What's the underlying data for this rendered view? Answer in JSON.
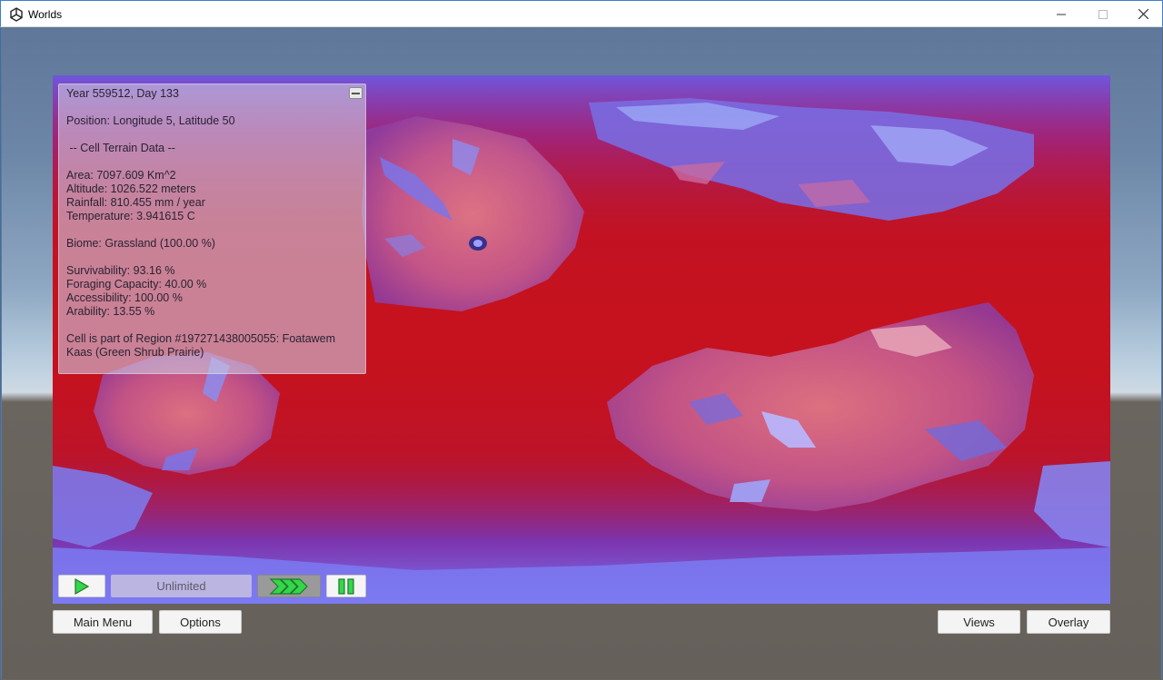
{
  "window": {
    "title": "Worlds"
  },
  "info": {
    "date": "Year 559512, Day 133",
    "position": "Position: Longitude 5, Latitude 50",
    "section_title": " -- Cell Terrain Data --",
    "area": "Area: 7097.609 Km^2",
    "altitude": "Altitude: 1026.522 meters",
    "rainfall": "Rainfall: 810.455 mm / year",
    "temperature": "Temperature: 3.941615 C",
    "biome": "Biome: Grassland (100.00 %)",
    "survivability": "Survivability: 93.16 %",
    "foraging": "Foraging Capacity: 40.00 %",
    "accessibility": "Accessibility: 100.00 %",
    "arability": "Arability: 13.55 %",
    "region": "Cell is part of Region #197271438005055: Foatawem Kaas (Green Shrub Prairie)"
  },
  "controls": {
    "speed_value": "Unlimited"
  },
  "buttons": {
    "main_menu": "Main Menu",
    "options": "Options",
    "views": "Views",
    "overlay": "Overlay"
  },
  "colors": {
    "ocean": "#c5121e",
    "cold": "#6a6af0",
    "play_green": "#35d64a"
  }
}
